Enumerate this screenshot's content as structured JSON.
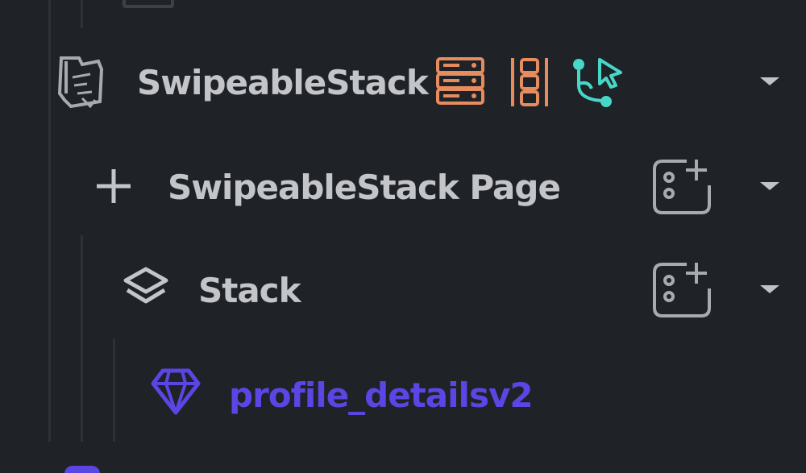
{
  "tree": {
    "items": [
      {
        "label": "SwipeableStack",
        "icons": [
          "custom-widget-icon",
          "backend-query-icon",
          "split-columns-icon",
          "action-flow-icon",
          "dropdown-caret-icon"
        ],
        "colors": {
          "query": "#e78c5e",
          "columns": "#e78c5e",
          "action": "#48d6c6"
        }
      },
      {
        "label": "SwipeableStack Page",
        "icons": [
          "add-icon",
          "add-child-widget-icon",
          "dropdown-caret-icon"
        ]
      },
      {
        "label": "Stack",
        "icons": [
          "layers-icon",
          "add-child-widget-icon",
          "dropdown-caret-icon"
        ]
      },
      {
        "label": "profile_detailsv2",
        "icons": [
          "component-diamond-icon"
        ],
        "color": "#5b46e5"
      }
    ]
  },
  "theme": {
    "background": "#1f2226",
    "guide_line": "#2e3237",
    "text": "#c3c5c9",
    "accent": "#5b46e5"
  }
}
